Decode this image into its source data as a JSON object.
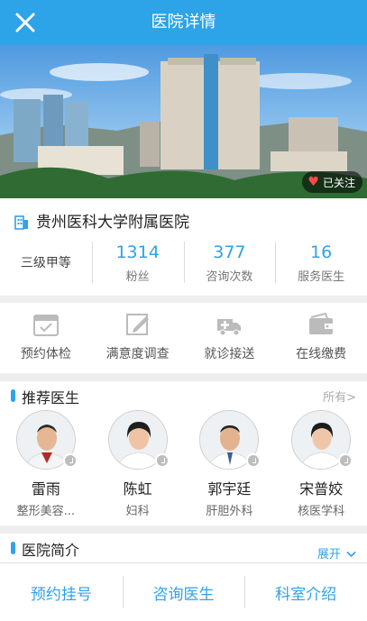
{
  "header": {
    "title": "医院详情"
  },
  "hero": {
    "follow_label": "已关注"
  },
  "hospital": {
    "name": "贵州医科大学附属医院",
    "grade": "三级甲等",
    "stats": [
      {
        "value": "1314",
        "label": "粉丝"
      },
      {
        "value": "377",
        "label": "咨询次数"
      },
      {
        "value": "16",
        "label": "服务医生"
      }
    ]
  },
  "services": [
    {
      "label": "预约体检",
      "icon": "calendar-icon"
    },
    {
      "label": "满意度调查",
      "icon": "edit-icon"
    },
    {
      "label": "就诊接送",
      "icon": "ambulance-icon"
    },
    {
      "label": "在线缴费",
      "icon": "wallet-icon"
    }
  ],
  "doctors_section": {
    "title": "推荐医生",
    "more_label": "所有>",
    "doctors": [
      {
        "name": "雷雨",
        "dept": "整形美容..."
      },
      {
        "name": "陈虹",
        "dept": "妇科"
      },
      {
        "name": "郭宇廷",
        "dept": "肝胆外科"
      },
      {
        "name": "宋普姣",
        "dept": "核医学科"
      }
    ]
  },
  "intro_section": {
    "title": "医院简介",
    "expand_label": "展开"
  },
  "bottom_tabs": [
    {
      "label": "预约挂号"
    },
    {
      "label": "咨询医生"
    },
    {
      "label": "科室介绍"
    }
  ],
  "colors": {
    "accent": "#2da3e8",
    "heart": "#ff4a4a"
  }
}
